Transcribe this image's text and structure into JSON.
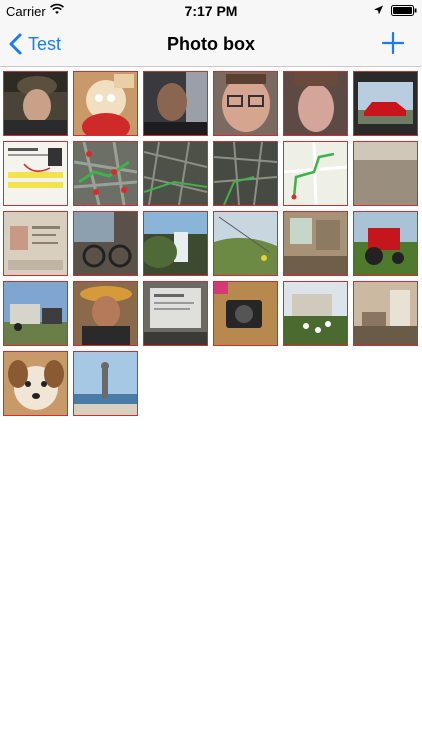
{
  "status_bar": {
    "carrier": "Carrier",
    "time": "7:17 PM",
    "icons": [
      "wifi-icon",
      "location-icon",
      "battery-icon"
    ]
  },
  "nav_bar": {
    "back_label": "Test",
    "title": "Photo box",
    "add_icon": "plus-icon"
  },
  "colors": {
    "accent": "#1a7cf5",
    "thumbnail_border": "#e0272c",
    "nav_background": "#f7f7f7"
  },
  "photos": [
    {
      "subject": "man-in-hat"
    },
    {
      "subject": "cartoon-figure"
    },
    {
      "subject": "bald-man-portrait"
    },
    {
      "subject": "man-with-glasses"
    },
    {
      "subject": "man-portrait"
    },
    {
      "subject": "red-car"
    },
    {
      "subject": "document-screenshot"
    },
    {
      "subject": "map-with-pins"
    },
    {
      "subject": "satellite-map"
    },
    {
      "subject": "satellite-map"
    },
    {
      "subject": "route-map"
    },
    {
      "subject": "empty-room-floor"
    },
    {
      "subject": "passport"
    },
    {
      "subject": "bike-in-shed"
    },
    {
      "subject": "waterfall"
    },
    {
      "subject": "grassy-hillside"
    },
    {
      "subject": "room-interior"
    },
    {
      "subject": "red-tractor"
    },
    {
      "subject": "truck-and-trailer"
    },
    {
      "subject": "person-with-hat"
    },
    {
      "subject": "computer-screen"
    },
    {
      "subject": "camera"
    },
    {
      "subject": "house-with-flowers"
    },
    {
      "subject": "kitchen-interior"
    },
    {
      "subject": "dog"
    },
    {
      "subject": "statue-by-sea"
    }
  ]
}
